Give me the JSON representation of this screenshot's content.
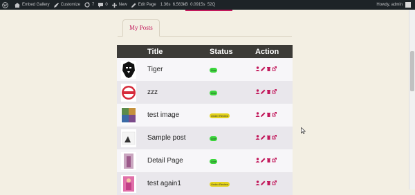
{
  "adminbar": {
    "site": "Embed Gallery",
    "customize": "Customize",
    "updates": "7",
    "comments": "0",
    "new": "New",
    "edit_page": "Edit Page",
    "perf_time": "1.36s",
    "perf_memory": "6,563kB",
    "perf_queries_time": "0.0915s",
    "perf_queries": "52Q",
    "greeting": "Howdy, admin"
  },
  "tab": {
    "label": "My Posts"
  },
  "table": {
    "headers": [
      "Title",
      "Status",
      "Action"
    ],
    "rows": [
      {
        "title": "Tiger",
        "status": "Live",
        "status_color": "#3bd63b",
        "thumb": "lion"
      },
      {
        "title": "zzz",
        "status": "Live",
        "status_color": "#3bd63b",
        "thumb": "badge-red"
      },
      {
        "title": "test image",
        "status": "Under Review",
        "status_color": "#e3d21c",
        "thumb": "collage"
      },
      {
        "title": "Sample post",
        "status": "Live",
        "status_color": "#3bd63b",
        "thumb": "white-photo"
      },
      {
        "title": "Detail Page",
        "status": "Live",
        "status_color": "#3bd63b",
        "thumb": "pink-photo"
      },
      {
        "title": "test again1",
        "status": "Under Review",
        "status_color": "#e3d21c",
        "thumb": "pink-person"
      }
    ]
  },
  "colors": {
    "accent": "#c2185b",
    "header_bg": "#3c3b37",
    "page_bg": "#f3efe3"
  }
}
